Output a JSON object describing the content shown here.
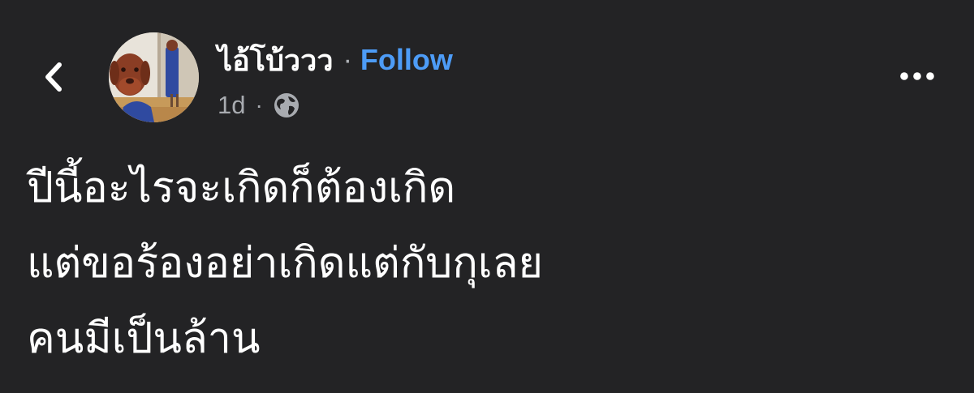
{
  "header": {
    "back_icon": "chevron-left-icon",
    "author_name": "ไอ้โบ้ววว",
    "separator": "·",
    "follow_label": "Follow",
    "time": "1d",
    "meta_separator": "·",
    "privacy_icon": "globe-icon",
    "more_icon": "more-horizontal-icon"
  },
  "post": {
    "lines": [
      "ปีนี้อะไรจะเกิดก็ต้องเกิด",
      "แต่ขอร้องอย่าเกิดแต่กับกุเลย",
      "คนมีเป็นล้าน"
    ]
  },
  "colors": {
    "background": "#232325",
    "text": "#ffffff",
    "muted": "#a8abb0",
    "link": "#4d9cf7"
  }
}
